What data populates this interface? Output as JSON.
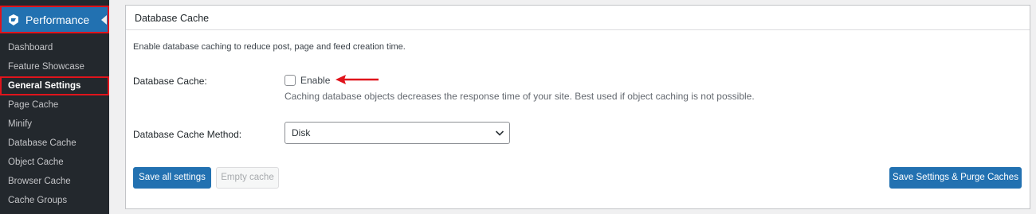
{
  "sidebar": {
    "header_label": "Performance",
    "items": [
      {
        "label": "Dashboard"
      },
      {
        "label": "Feature Showcase"
      },
      {
        "label": "General Settings"
      },
      {
        "label": "Page Cache"
      },
      {
        "label": "Minify"
      },
      {
        "label": "Database Cache"
      },
      {
        "label": "Object Cache"
      },
      {
        "label": "Browser Cache"
      },
      {
        "label": "Cache Groups"
      }
    ]
  },
  "panel": {
    "title": "Database Cache",
    "description": "Enable database caching to reduce post, page and feed creation time.",
    "db_cache": {
      "label": "Database Cache:",
      "checkbox_label": "Enable",
      "checked": false,
      "hint": "Caching database objects decreases the response time of your site. Best used if object caching is not possible."
    },
    "method": {
      "label": "Database Cache Method:",
      "selected": "Disk"
    },
    "buttons": {
      "save_all": "Save all settings",
      "empty_cache": "Empty cache",
      "save_purge": "Save Settings & Purge Caches"
    }
  },
  "colors": {
    "sidebar_bg": "#23282d",
    "accent": "#2271b1",
    "highlight": "#e0141c"
  }
}
